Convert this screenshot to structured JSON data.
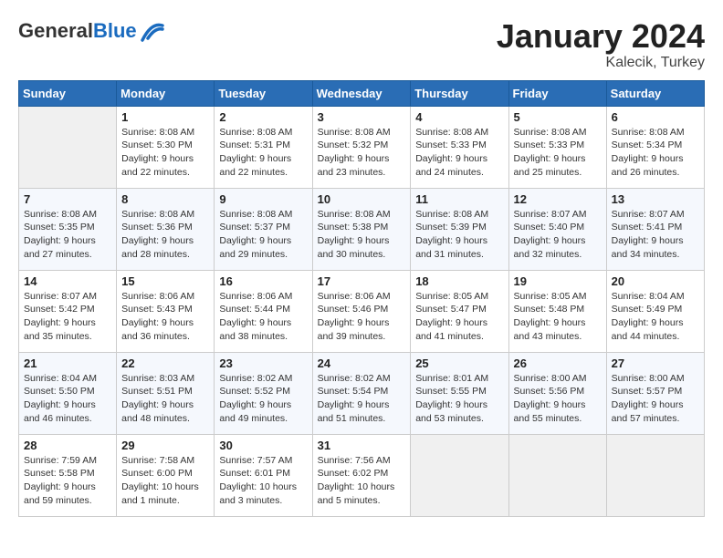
{
  "header": {
    "logo_general": "General",
    "logo_blue": "Blue",
    "month": "January 2024",
    "location": "Kalecik, Turkey"
  },
  "days_of_week": [
    "Sunday",
    "Monday",
    "Tuesday",
    "Wednesday",
    "Thursday",
    "Friday",
    "Saturday"
  ],
  "weeks": [
    [
      {
        "empty": true
      },
      {
        "day": 1,
        "sunrise": "8:08 AM",
        "sunset": "5:30 PM",
        "daylight": "9 hours and 22 minutes."
      },
      {
        "day": 2,
        "sunrise": "8:08 AM",
        "sunset": "5:31 PM",
        "daylight": "9 hours and 22 minutes."
      },
      {
        "day": 3,
        "sunrise": "8:08 AM",
        "sunset": "5:32 PM",
        "daylight": "9 hours and 23 minutes."
      },
      {
        "day": 4,
        "sunrise": "8:08 AM",
        "sunset": "5:33 PM",
        "daylight": "9 hours and 24 minutes."
      },
      {
        "day": 5,
        "sunrise": "8:08 AM",
        "sunset": "5:33 PM",
        "daylight": "9 hours and 25 minutes."
      },
      {
        "day": 6,
        "sunrise": "8:08 AM",
        "sunset": "5:34 PM",
        "daylight": "9 hours and 26 minutes."
      }
    ],
    [
      {
        "day": 7,
        "sunrise": "8:08 AM",
        "sunset": "5:35 PM",
        "daylight": "9 hours and 27 minutes."
      },
      {
        "day": 8,
        "sunrise": "8:08 AM",
        "sunset": "5:36 PM",
        "daylight": "9 hours and 28 minutes."
      },
      {
        "day": 9,
        "sunrise": "8:08 AM",
        "sunset": "5:37 PM",
        "daylight": "9 hours and 29 minutes."
      },
      {
        "day": 10,
        "sunrise": "8:08 AM",
        "sunset": "5:38 PM",
        "daylight": "9 hours and 30 minutes."
      },
      {
        "day": 11,
        "sunrise": "8:08 AM",
        "sunset": "5:39 PM",
        "daylight": "9 hours and 31 minutes."
      },
      {
        "day": 12,
        "sunrise": "8:07 AM",
        "sunset": "5:40 PM",
        "daylight": "9 hours and 32 minutes."
      },
      {
        "day": 13,
        "sunrise": "8:07 AM",
        "sunset": "5:41 PM",
        "daylight": "9 hours and 34 minutes."
      }
    ],
    [
      {
        "day": 14,
        "sunrise": "8:07 AM",
        "sunset": "5:42 PM",
        "daylight": "9 hours and 35 minutes."
      },
      {
        "day": 15,
        "sunrise": "8:06 AM",
        "sunset": "5:43 PM",
        "daylight": "9 hours and 36 minutes."
      },
      {
        "day": 16,
        "sunrise": "8:06 AM",
        "sunset": "5:44 PM",
        "daylight": "9 hours and 38 minutes."
      },
      {
        "day": 17,
        "sunrise": "8:06 AM",
        "sunset": "5:46 PM",
        "daylight": "9 hours and 39 minutes."
      },
      {
        "day": 18,
        "sunrise": "8:05 AM",
        "sunset": "5:47 PM",
        "daylight": "9 hours and 41 minutes."
      },
      {
        "day": 19,
        "sunrise": "8:05 AM",
        "sunset": "5:48 PM",
        "daylight": "9 hours and 43 minutes."
      },
      {
        "day": 20,
        "sunrise": "8:04 AM",
        "sunset": "5:49 PM",
        "daylight": "9 hours and 44 minutes."
      }
    ],
    [
      {
        "day": 21,
        "sunrise": "8:04 AM",
        "sunset": "5:50 PM",
        "daylight": "9 hours and 46 minutes."
      },
      {
        "day": 22,
        "sunrise": "8:03 AM",
        "sunset": "5:51 PM",
        "daylight": "9 hours and 48 minutes."
      },
      {
        "day": 23,
        "sunrise": "8:02 AM",
        "sunset": "5:52 PM",
        "daylight": "9 hours and 49 minutes."
      },
      {
        "day": 24,
        "sunrise": "8:02 AM",
        "sunset": "5:54 PM",
        "daylight": "9 hours and 51 minutes."
      },
      {
        "day": 25,
        "sunrise": "8:01 AM",
        "sunset": "5:55 PM",
        "daylight": "9 hours and 53 minutes."
      },
      {
        "day": 26,
        "sunrise": "8:00 AM",
        "sunset": "5:56 PM",
        "daylight": "9 hours and 55 minutes."
      },
      {
        "day": 27,
        "sunrise": "8:00 AM",
        "sunset": "5:57 PM",
        "daylight": "9 hours and 57 minutes."
      }
    ],
    [
      {
        "day": 28,
        "sunrise": "7:59 AM",
        "sunset": "5:58 PM",
        "daylight": "9 hours and 59 minutes."
      },
      {
        "day": 29,
        "sunrise": "7:58 AM",
        "sunset": "6:00 PM",
        "daylight": "10 hours and 1 minute."
      },
      {
        "day": 30,
        "sunrise": "7:57 AM",
        "sunset": "6:01 PM",
        "daylight": "10 hours and 3 minutes."
      },
      {
        "day": 31,
        "sunrise": "7:56 AM",
        "sunset": "6:02 PM",
        "daylight": "10 hours and 5 minutes."
      },
      {
        "empty": true
      },
      {
        "empty": true
      },
      {
        "empty": true
      }
    ]
  ]
}
